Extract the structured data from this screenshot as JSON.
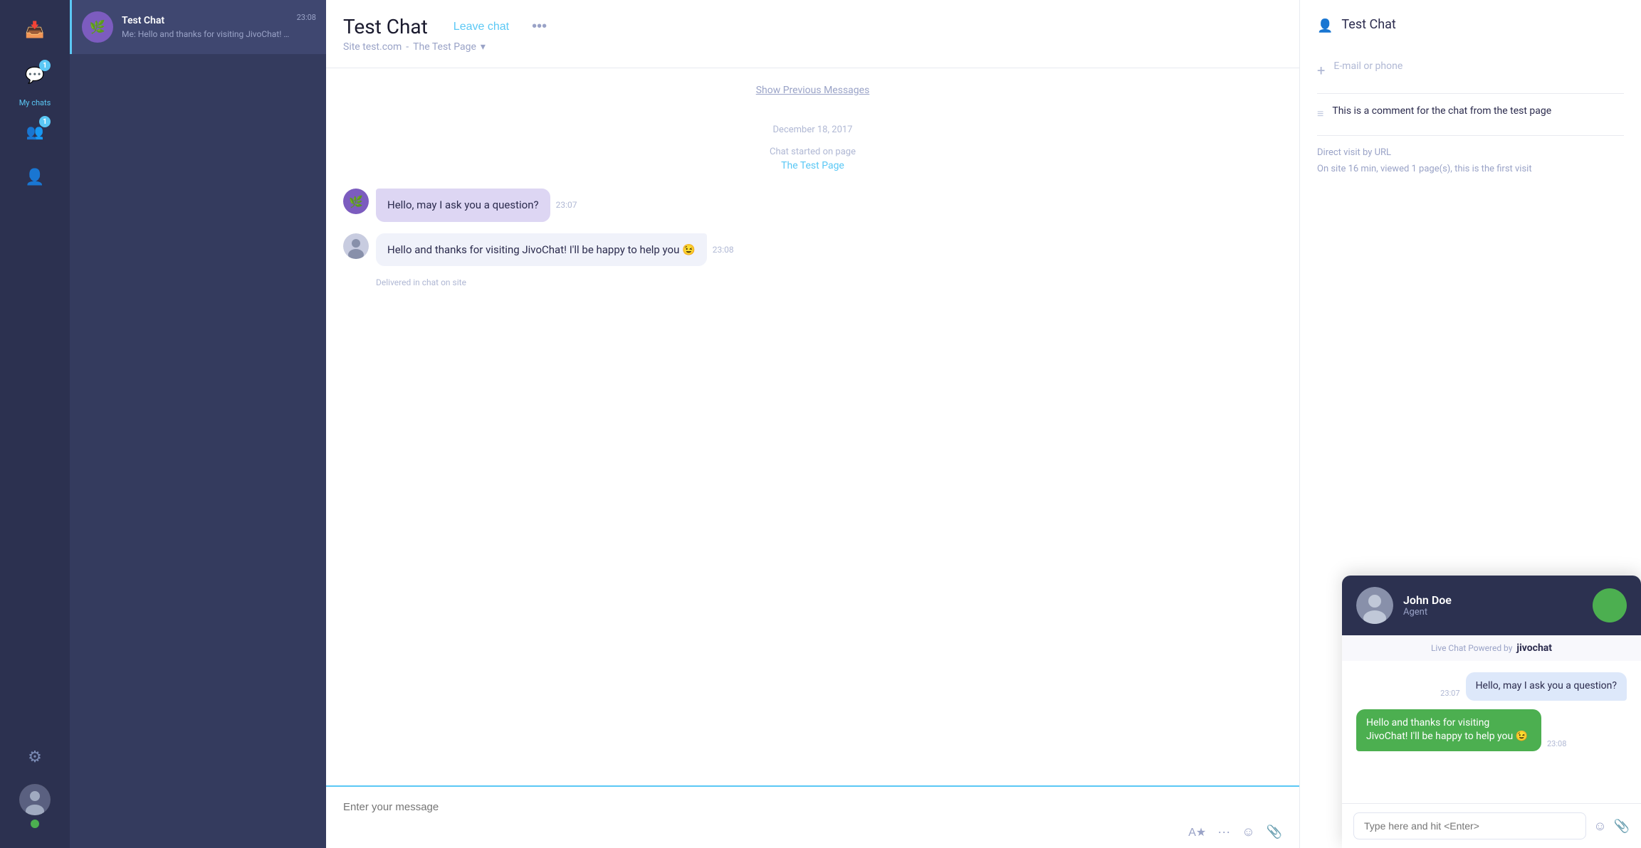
{
  "sidebar": {
    "inbox_badge": "1",
    "mychats_badge": "1",
    "nav_items": [
      {
        "id": "inbox",
        "icon": "📥",
        "label": ""
      },
      {
        "id": "mychats",
        "icon": "💬",
        "label": "My chats",
        "badge": "1"
      },
      {
        "id": "visitors",
        "icon": "👥",
        "label": "",
        "badge": "1"
      },
      {
        "id": "team",
        "icon": "👤",
        "label": ""
      }
    ],
    "settings_icon": "⚙",
    "avatar_alt": "Agent avatar"
  },
  "chat_list": {
    "items": [
      {
        "id": "test-chat",
        "name": "Test Chat",
        "preview": "Me: Hello and thanks for visiting JivoChat! I'll be happy to help you...",
        "time": "23:08",
        "avatar_icon": "🌿"
      }
    ]
  },
  "main_chat": {
    "title": "Test Chat",
    "leave_chat": "Leave chat",
    "more_icon": "•••",
    "subtitle_site": "Site test.com",
    "subtitle_separator": "-",
    "subtitle_page": "The Test Page",
    "chevron": "▾",
    "show_previous": "Show Previous Messages",
    "date_divider": "December 18, 2017",
    "chat_started": "Chat started on page",
    "chat_started_page": "The Test Page",
    "messages": [
      {
        "id": "msg1",
        "type": "visitor",
        "text": "Hello, may I ask you a question?",
        "time": "23:07"
      },
      {
        "id": "msg2",
        "type": "agent",
        "text": "Hello and thanks for visiting JivoChat! I'll be happy to help you 😉",
        "time": "23:08",
        "status": "Delivered in chat on site"
      }
    ],
    "input_placeholder": "Enter your message",
    "toolbar": {
      "translate": "A★",
      "dots": "···",
      "emoji": "☺",
      "attach": "📎"
    }
  },
  "right_panel": {
    "title": "Test Chat",
    "email_placeholder": "E-mail or phone",
    "comment": "This is a comment for the chat from the test page",
    "visit_type": "Direct visit by URL",
    "visit_stats": "On site 16 min, viewed 1 page(s), this is the first visit"
  },
  "widget": {
    "agent_name": "John Doe",
    "agent_role": "Agent",
    "powered_by": "Live Chat Powered by",
    "brand": "jivochat",
    "messages": [
      {
        "type": "visitor",
        "text": "Hello, may I ask you a question?",
        "time": "23:07"
      },
      {
        "type": "agent",
        "text": "Hello and thanks for visiting JivoChat!\nI'll be happy to help you 😉",
        "time": "23:08"
      }
    ],
    "input_placeholder": "Type here and hit <Enter>",
    "emoji_icon": "☺",
    "attach_icon": "📎"
  }
}
